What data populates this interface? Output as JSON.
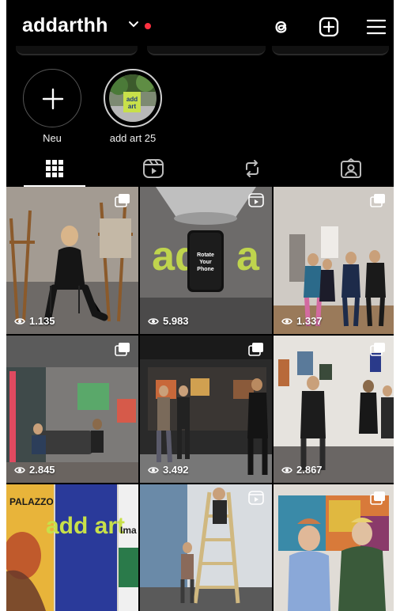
{
  "header": {
    "username": "addarthh",
    "icons": [
      "chevron-down-icon",
      "threads-icon",
      "create-post-icon",
      "menu-icon"
    ],
    "notification_color": "#ff3040"
  },
  "highlights": [
    {
      "label": "Neu",
      "icon": "plus-icon"
    },
    {
      "label": "add art 25",
      "cover_text": "add art",
      "cover_color": "#c8e04a"
    }
  ],
  "tabs": [
    {
      "name": "posts",
      "icon": "grid-icon",
      "active": true
    },
    {
      "name": "reels",
      "icon": "reels-icon",
      "active": false
    },
    {
      "name": "reposts",
      "icon": "repost-icon",
      "active": false
    },
    {
      "name": "tagged",
      "icon": "tagged-icon",
      "active": false
    }
  ],
  "posts": [
    {
      "views": "1.135",
      "type": "carousel"
    },
    {
      "views": "5.983",
      "type": "reel",
      "phone_text": "Rotate Your Phone",
      "sign_text": "add a"
    },
    {
      "views": "1.337",
      "type": "carousel"
    },
    {
      "views": "2.845",
      "type": "carousel"
    },
    {
      "views": "3.492",
      "type": "carousel"
    },
    {
      "views": "2.867",
      "type": "carousel"
    },
    {
      "views": "",
      "type": "carousel",
      "poster_title": "PALAZZO",
      "poster_text": "add art",
      "poster_side": "Ima"
    },
    {
      "views": "",
      "type": "reel"
    },
    {
      "views": "",
      "type": "carousel"
    }
  ]
}
